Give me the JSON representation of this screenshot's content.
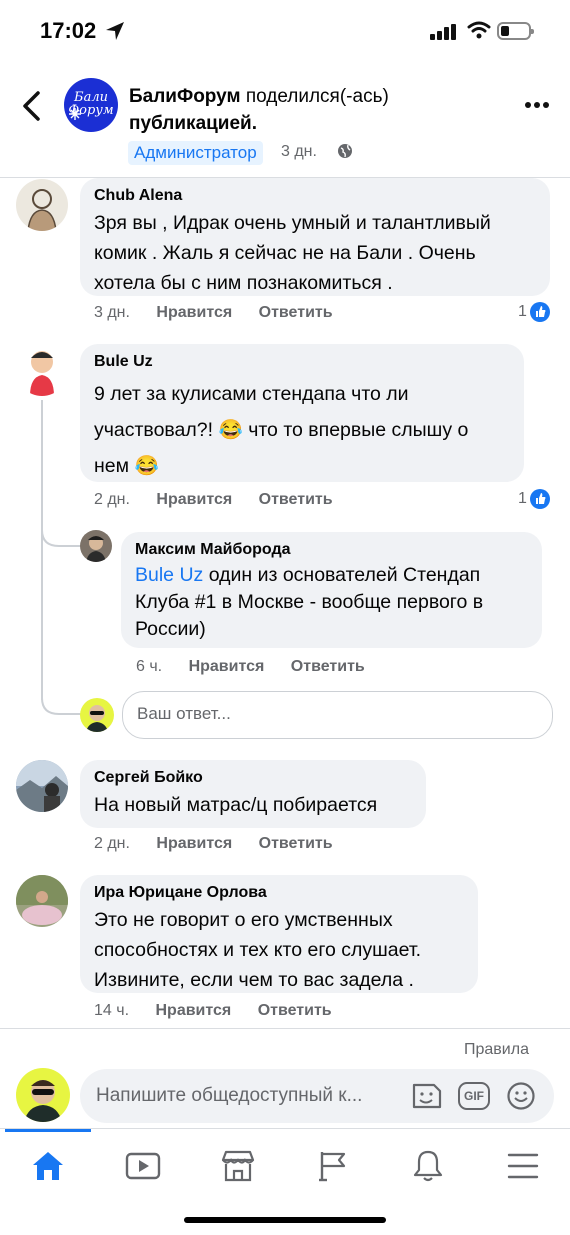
{
  "status": {
    "time": "17:02"
  },
  "header": {
    "page_name": "БалиФорум",
    "action_part1": "поделился(-ась)",
    "action_part2": "публикацией.",
    "logo_text": "Бали Форум",
    "badge": "Администратор",
    "time": "3 дн."
  },
  "comments": [
    {
      "author": "Chub Alena",
      "lines": [
        "Зря вы , Идрак очень умный и талантливый",
        "комик . Жаль я сейчас не на Бали . Очень",
        "хотела бы с ним познакомиться ."
      ],
      "time": "3 дн.",
      "like": "Нравится",
      "reply": "Ответить",
      "reactions": "1"
    },
    {
      "author": "Bule Uz",
      "line1": "9 лет за кулисами стендапа что ли",
      "line2": "участвовал?!",
      "emoji2": "😂",
      "line2b": "что то впервые слышу о",
      "line3": "нем",
      "emoji3": "😂",
      "time": "2 дн.",
      "like": "Нравится",
      "reply": "Ответить",
      "reactions": "1"
    },
    {
      "author": "Сергей Бойко",
      "lines": [
        "На новый матрас/ц побирается"
      ],
      "time": "2 дн.",
      "like": "Нравится",
      "reply": "Ответить"
    },
    {
      "author": "Ира Юрицане Орлова",
      "lines": [
        "Это не говорит о его умственных",
        "способностях и тех кто его слушает.",
        "Извините, если чем то вас задела ."
      ],
      "time": "14 ч.",
      "like": "Нравится",
      "reply": "Ответить"
    }
  ],
  "reply": {
    "author": "Максим Майборода",
    "mention": "Bule Uz",
    "line1": "один из основателей Стендап",
    "line2": "Клуба #1 в Москве - вообще первого в",
    "line3": "России)",
    "time": "6 ч.",
    "like": "Нравится",
    "reply": "Ответить"
  },
  "reply_input": {
    "placeholder": "Ваш ответ..."
  },
  "rules_link": "Правила",
  "composer": {
    "placeholder": "Напишите общедоступный к...",
    "gif_label": "GIF"
  },
  "tabs": [
    "home",
    "watch",
    "marketplace",
    "pages",
    "notifications",
    "menu"
  ],
  "colors": {
    "accent": "#1877f2",
    "bubble": "#f0f2f5",
    "secondary_text": "#65676b"
  }
}
